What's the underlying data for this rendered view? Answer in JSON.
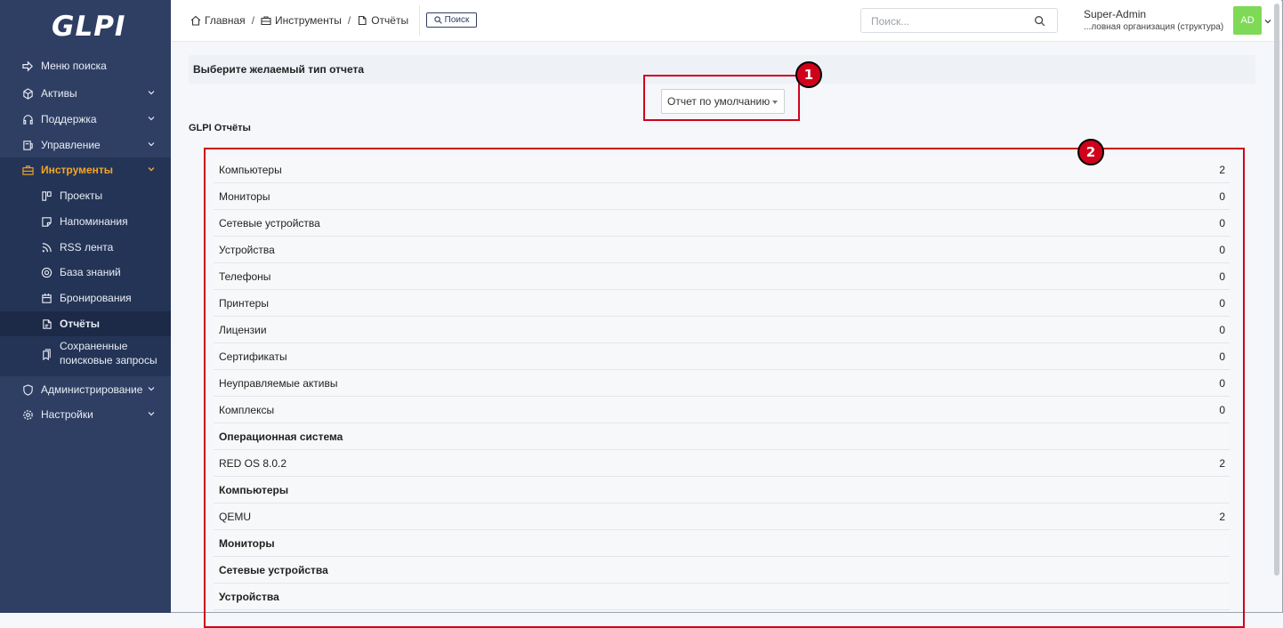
{
  "sidebar": {
    "logo": "GLPI",
    "items": [
      {
        "label": "Меню поиска",
        "icon": "arrow-right-icon"
      },
      {
        "label": "Активы",
        "icon": "cube-icon"
      },
      {
        "label": "Поддержка",
        "icon": "headset-icon"
      },
      {
        "label": "Управление",
        "icon": "wallet-icon"
      },
      {
        "label": "Инструменты",
        "icon": "briefcase-icon"
      },
      {
        "label": "Администрирование",
        "icon": "shield-icon"
      },
      {
        "label": "Настройки",
        "icon": "gear-icon"
      }
    ],
    "subitems": [
      {
        "label": "Проекты",
        "icon": "kanban-icon"
      },
      {
        "label": "Напоминания",
        "icon": "note-icon"
      },
      {
        "label": "RSS лента",
        "icon": "rss-icon"
      },
      {
        "label": "База знаний",
        "icon": "lifebuoy-icon"
      },
      {
        "label": "Бронирования",
        "icon": "calendar-icon"
      },
      {
        "label": "Отчёты",
        "icon": "report-icon"
      },
      {
        "label_line1": "Сохраненные",
        "label_line2": "поисковые запросы",
        "icon": "bookmarks-icon"
      }
    ]
  },
  "header": {
    "breadcrumb": [
      "Главная",
      "Инструменты",
      "Отчёты"
    ],
    "search_button": "Поиск",
    "search_placeholder": "Поиск...",
    "user_name": "Super-Admin",
    "user_entity": "...ловная организация (структура)",
    "avatar_initials": "AD"
  },
  "main": {
    "select_report_title": "Выберите желаемый тип отчета",
    "report_type_selected": "Отчет по умолчанию",
    "section_title": "GLPI Отчёты",
    "rows": [
      {
        "label": "Компьютеры",
        "value": "2",
        "header": false
      },
      {
        "label": "Мониторы",
        "value": "0",
        "header": false
      },
      {
        "label": "Сетевые устройства",
        "value": "0",
        "header": false
      },
      {
        "label": "Устройства",
        "value": "0",
        "header": false
      },
      {
        "label": "Телефоны",
        "value": "0",
        "header": false
      },
      {
        "label": "Принтеры",
        "value": "0",
        "header": false
      },
      {
        "label": "Лицензии",
        "value": "0",
        "header": false
      },
      {
        "label": "Сертификаты",
        "value": "0",
        "header": false
      },
      {
        "label": "Неуправляемые активы",
        "value": "0",
        "header": false
      },
      {
        "label": "Комплексы",
        "value": "0",
        "header": false
      },
      {
        "label": "Операционная система",
        "value": "",
        "header": true
      },
      {
        "label": "RED OS 8.0.2",
        "value": "2",
        "header": false
      },
      {
        "label": "Компьютеры",
        "value": "",
        "header": true
      },
      {
        "label": "QEMU",
        "value": "2",
        "header": false
      },
      {
        "label": "Мониторы",
        "value": "",
        "header": true
      },
      {
        "label": "Сетевые устройства",
        "value": "",
        "header": true
      },
      {
        "label": "Устройства",
        "value": "",
        "header": true
      }
    ]
  },
  "annotations": {
    "badge1": "1",
    "badge2": "2",
    "color": "#d0021b"
  },
  "colors": {
    "sidebar": "#2f3f64",
    "active": "#f5a623",
    "avatar": "#7ed957"
  }
}
